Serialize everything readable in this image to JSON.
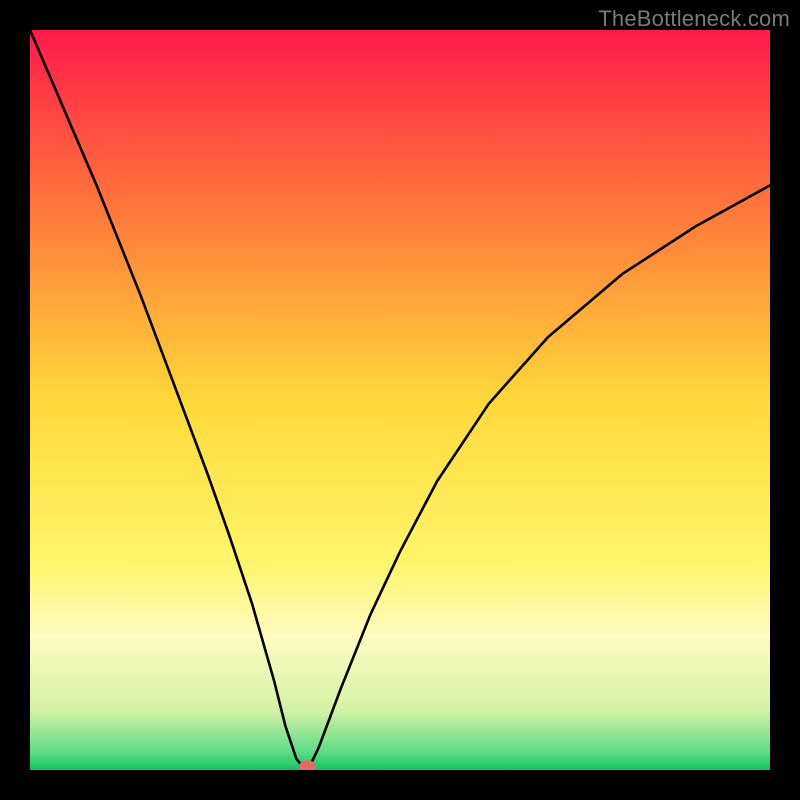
{
  "watermark": "TheBottleneck.com",
  "chart_data": {
    "type": "line",
    "title": "",
    "xlabel": "",
    "ylabel": "",
    "xlim": [
      0,
      100
    ],
    "ylim": [
      0,
      100
    ],
    "background_gradient": {
      "stops": [
        {
          "offset": 0.0,
          "color": "#ff1a4b"
        },
        {
          "offset": 0.25,
          "color": "#ff7a3a"
        },
        {
          "offset": 0.5,
          "color": "#ffd83a"
        },
        {
          "offset": 0.72,
          "color": "#fff56a"
        },
        {
          "offset": 0.82,
          "color": "#fffbc2"
        },
        {
          "offset": 0.92,
          "color": "#d2f2a5"
        },
        {
          "offset": 0.975,
          "color": "#5fdc88"
        },
        {
          "offset": 1.0,
          "color": "#15c25c"
        }
      ]
    },
    "series": [
      {
        "name": "bottleneck-curve",
        "x": [
          0,
          3,
          6,
          9,
          12,
          15,
          18,
          21,
          24,
          27,
          30,
          33,
          34.5,
          36,
          37,
          37.8,
          39,
          42,
          46,
          50,
          55,
          62,
          70,
          80,
          90,
          100
        ],
        "y": [
          100,
          93,
          86,
          79,
          71.5,
          64,
          56,
          48,
          40,
          31.5,
          22.5,
          12,
          6,
          1.5,
          0.3,
          0.5,
          3,
          11,
          21,
          29.5,
          39,
          49.5,
          58.5,
          67,
          73.5,
          79
        ],
        "color": "#000000",
        "width": 2.6
      }
    ],
    "markers": [
      {
        "name": "min-marker",
        "x": 37.5,
        "y": 0.5,
        "color": "#e46a6a",
        "r": 6
      }
    ]
  }
}
